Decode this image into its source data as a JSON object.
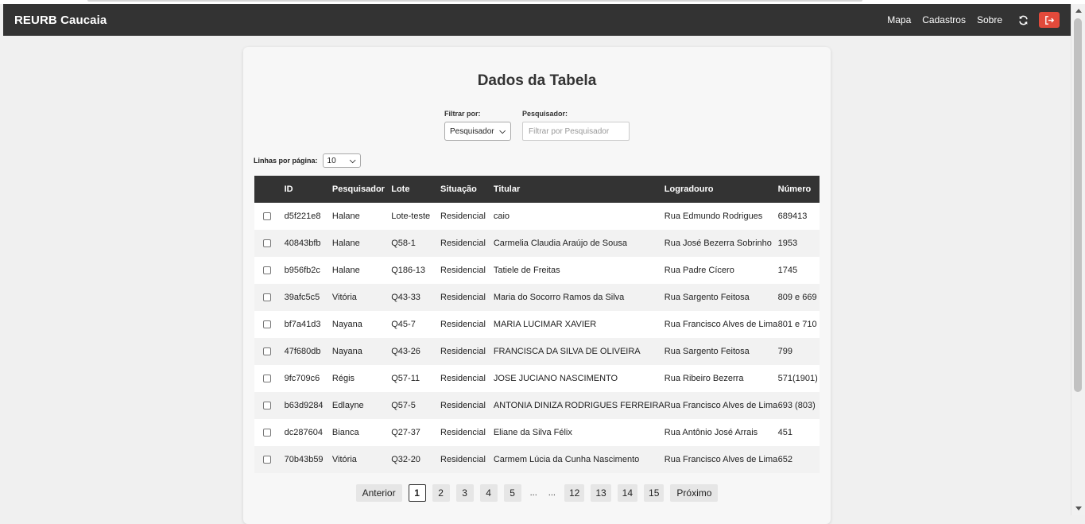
{
  "navbar": {
    "brand": "REURB Caucaia",
    "links": [
      "Mapa",
      "Cadastros",
      "Sobre"
    ],
    "refresh_icon": "refresh-icon",
    "logout_icon": "logout-icon",
    "logout_color": "#e24a3b"
  },
  "main": {
    "title": "Dados da Tabela",
    "filter": {
      "filter_by_label": "Filtrar por:",
      "filter_by_value": "Pesquisador",
      "search_label": "Pesquisador:",
      "search_placeholder": "Filtrar por Pesquisador",
      "search_value": ""
    },
    "rows_per_page": {
      "label": "Linhas por página:",
      "value": "10"
    },
    "table": {
      "columns": [
        "ID",
        "Pesquisador",
        "Lote",
        "Situação",
        "Titular",
        "Logradouro",
        "Número"
      ],
      "rows": [
        [
          "d5f221e8",
          "Halane",
          "Lote-teste",
          "Residencial",
          "caio",
          "Rua Edmundo Rodrigues",
          "689413"
        ],
        [
          "40843bfb",
          "Halane",
          "Q58-1",
          "Residencial",
          "Carmelia Claudia Araújo de Sousa",
          "Rua José Bezerra Sobrinho",
          "1953"
        ],
        [
          "b956fb2c",
          "Halane",
          "Q186-13",
          "Residencial",
          "Tatiele de Freitas",
          "Rua Padre Cícero",
          "1745"
        ],
        [
          "39afc5c5",
          "Vitória",
          "Q43-33",
          "Residencial",
          "Maria do Socorro Ramos da Silva",
          "Rua Sargento Feitosa",
          "809 e 669"
        ],
        [
          "bf7a41d3",
          "Nayana",
          "Q45-7",
          "Residencial",
          "MARIA LUCIMAR XAVIER",
          "Rua Francisco Alves de Lima",
          "801 e 710"
        ],
        [
          "47f680db",
          "Nayana",
          "Q43-26",
          "Residencial",
          "FRANCISCA DA SILVA DE OLIVEIRA",
          "Rua Sargento Feitosa",
          "799"
        ],
        [
          "9fc709c6",
          "Régis",
          "Q57-11",
          "Residencial",
          "JOSE JUCIANO NASCIMENTO",
          "Rua Ribeiro Bezerra",
          "571(1901)"
        ],
        [
          "b63d9284",
          "Edlayne",
          "Q57-5",
          "Residencial",
          "ANTONIA DINIZA RODRIGUES FERREIRA",
          "Rua Francisco Alves de Lima",
          "693 (803)"
        ],
        [
          "dc287604",
          "Bianca",
          "Q27-37",
          "Residencial",
          "Eliane da Silva Félix",
          "Rua Antônio José Arrais",
          "451"
        ],
        [
          "70b43b59",
          "Vitória",
          "Q32-20",
          "Residencial",
          "Carmem Lúcia da Cunha Nascimento",
          "Rua Francisco Alves de Lima",
          "652"
        ]
      ]
    },
    "pagination": {
      "prev": "Anterior",
      "next": "Próximo",
      "pages_start": [
        "1",
        "2",
        "3",
        "4",
        "5"
      ],
      "ellipsis": [
        "...",
        "..."
      ],
      "pages_end": [
        "12",
        "13",
        "14",
        "15"
      ],
      "current": "1"
    }
  }
}
